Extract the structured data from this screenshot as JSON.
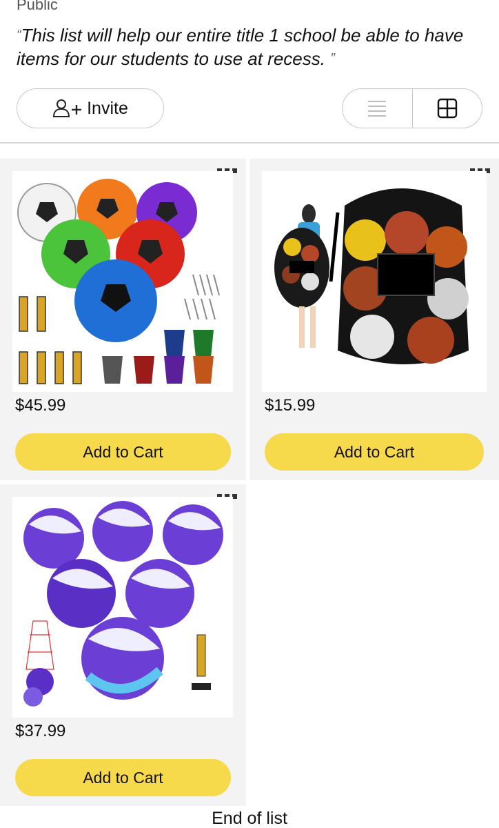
{
  "list": {
    "visibility": "Public",
    "description": "This list will help our entire title 1 school be able to have items for our students to use at recess.",
    "quote_open": "“",
    "quote_close": "”"
  },
  "toolbar": {
    "invite_label": "Invite",
    "view_options": [
      "list-view-icon",
      "grid-view-icon"
    ],
    "active_view": "grid"
  },
  "items": [
    {
      "price": "$45.99",
      "cart_label": "Add to Cart",
      "image": "soccer-balls-set-with-pumps-and-bags"
    },
    {
      "price": "$15.99",
      "cart_label": "Add to Cart",
      "image": "mesh-ball-bag-with-balls"
    },
    {
      "price": "$37.99",
      "cart_label": "Add to Cart",
      "image": "volleyballs-set-with-pump-and-net"
    }
  ],
  "footer": {
    "end_label": "End of list"
  },
  "colors": {
    "cart_button": "#f7d94c",
    "card_bg": "#f3f3f4"
  }
}
